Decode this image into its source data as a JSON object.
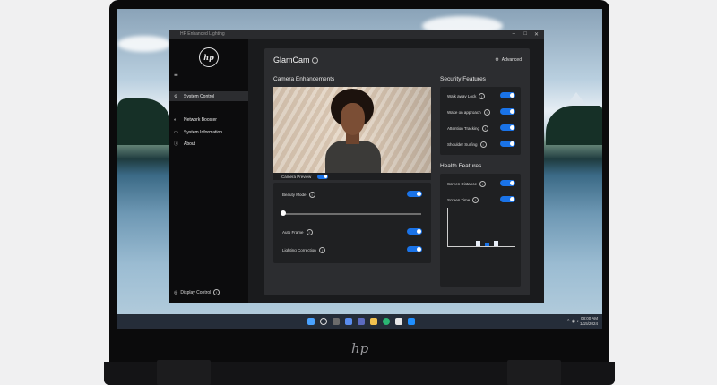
{
  "device": {
    "brand_logo": "hp"
  },
  "app": {
    "window_title": "HP Enhanced Lighting",
    "logo": "hp",
    "sidebar": {
      "items": [
        {
          "label": "System Control",
          "icon": "system-control-icon",
          "active": true
        },
        {
          "label": "Network Booster",
          "icon": "network-booster-icon",
          "active": false
        },
        {
          "label": "System Information",
          "icon": "system-information-icon",
          "active": false
        },
        {
          "label": "About",
          "icon": "about-icon",
          "active": false
        }
      ],
      "bottom_label": "Display Control"
    },
    "main": {
      "title": "GlamCam",
      "advanced_label": "Advanced",
      "camera": {
        "heading": "Camera Enhancements",
        "preview_label": "Camera Preview",
        "beauty_label": "Beauty Mode",
        "auto_frame_label": "Auto Frame",
        "lighting_label": "Lighting Correction",
        "beauty_level": 0
      },
      "security": {
        "heading": "Security Features",
        "items": [
          {
            "label": "Walk away Lock",
            "on": true
          },
          {
            "label": "Wake on approach",
            "on": true
          },
          {
            "label": "Attention Tracking",
            "on": true
          },
          {
            "label": "Shoulder Surfing",
            "on": true
          }
        ]
      },
      "health": {
        "heading": "Health Features",
        "items": [
          {
            "label": "Screen Distance",
            "on": true
          },
          {
            "label": "Screen Time",
            "on": true
          }
        ]
      }
    }
  },
  "taskbar": {
    "time": "08:00 AM",
    "date": "1/15/2024"
  },
  "colors": {
    "accent": "#1a73e8",
    "panel": "#2c2d30",
    "sidebar": "#0c0c0d"
  },
  "chart_data": {
    "type": "bar",
    "categories": [
      "1",
      "2",
      "3",
      "4",
      "5",
      "6",
      "7"
    ],
    "values": [
      0,
      0,
      0,
      4,
      3,
      4,
      0
    ],
    "title": "",
    "xlabel": "",
    "ylabel": "",
    "ylim": [
      0,
      30
    ]
  }
}
